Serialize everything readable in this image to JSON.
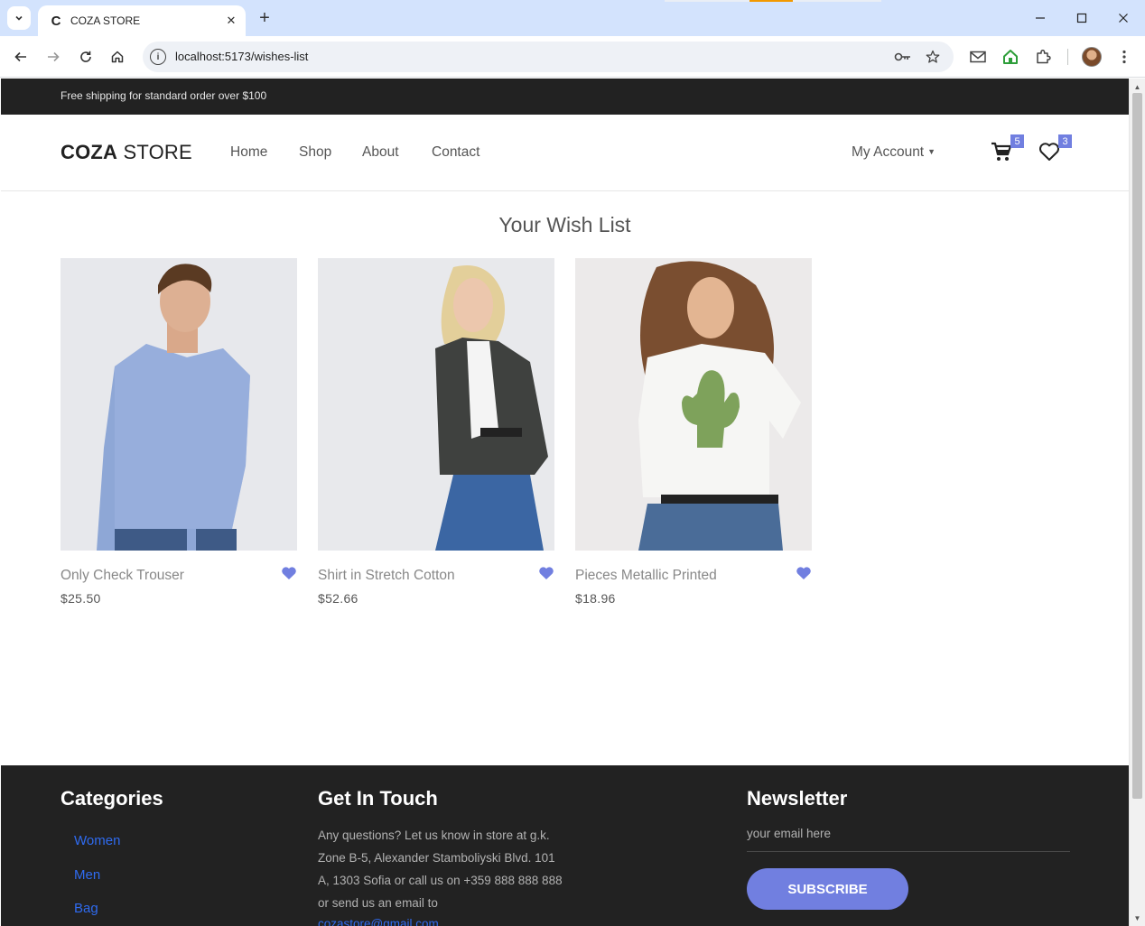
{
  "browser": {
    "tab_title": "COZA STORE",
    "tab_favicon": "C",
    "url": "localhost:5173/wishes-list",
    "new_tab": "+",
    "close_tab": "✕"
  },
  "topbar": {
    "text": "Free shipping for standard order over $100"
  },
  "header": {
    "logo_bold": "COZA",
    "logo_light": "STORE",
    "nav": [
      "Home",
      "Shop",
      "About",
      "Contact"
    ],
    "account_label": "My Account",
    "cart_count": "5",
    "wishlist_count": "3"
  },
  "wishlist": {
    "title": "Your Wish List",
    "items": [
      {
        "name": "Only Check Trouser",
        "price": "$25.50"
      },
      {
        "name": "Shirt in Stretch Cotton",
        "price": "$52.66"
      },
      {
        "name": "Pieces Metallic Printed",
        "price": "$18.96"
      }
    ]
  },
  "footer": {
    "categories_title": "Categories",
    "categories": [
      "Women",
      "Men",
      "Bag"
    ],
    "touch_title": "Get In Touch",
    "touch_text": "Any questions? Let us know in store at g.k. Zone B-5, Alexander Stamboliyski Blvd. 101 A, 1303 Sofia or call us on +359 888 888 888 or send us an email to",
    "touch_email": "cozastore@gmail.com",
    "newsletter_title": "Newsletter",
    "newsletter_placeholder": "your email here",
    "subscribe_label": "SUBSCRIBE"
  },
  "colors": {
    "accent": "#717fe0",
    "topbar_bg": "#222222",
    "footer_bg": "#222222",
    "link_blue": "#2f6bf0"
  }
}
